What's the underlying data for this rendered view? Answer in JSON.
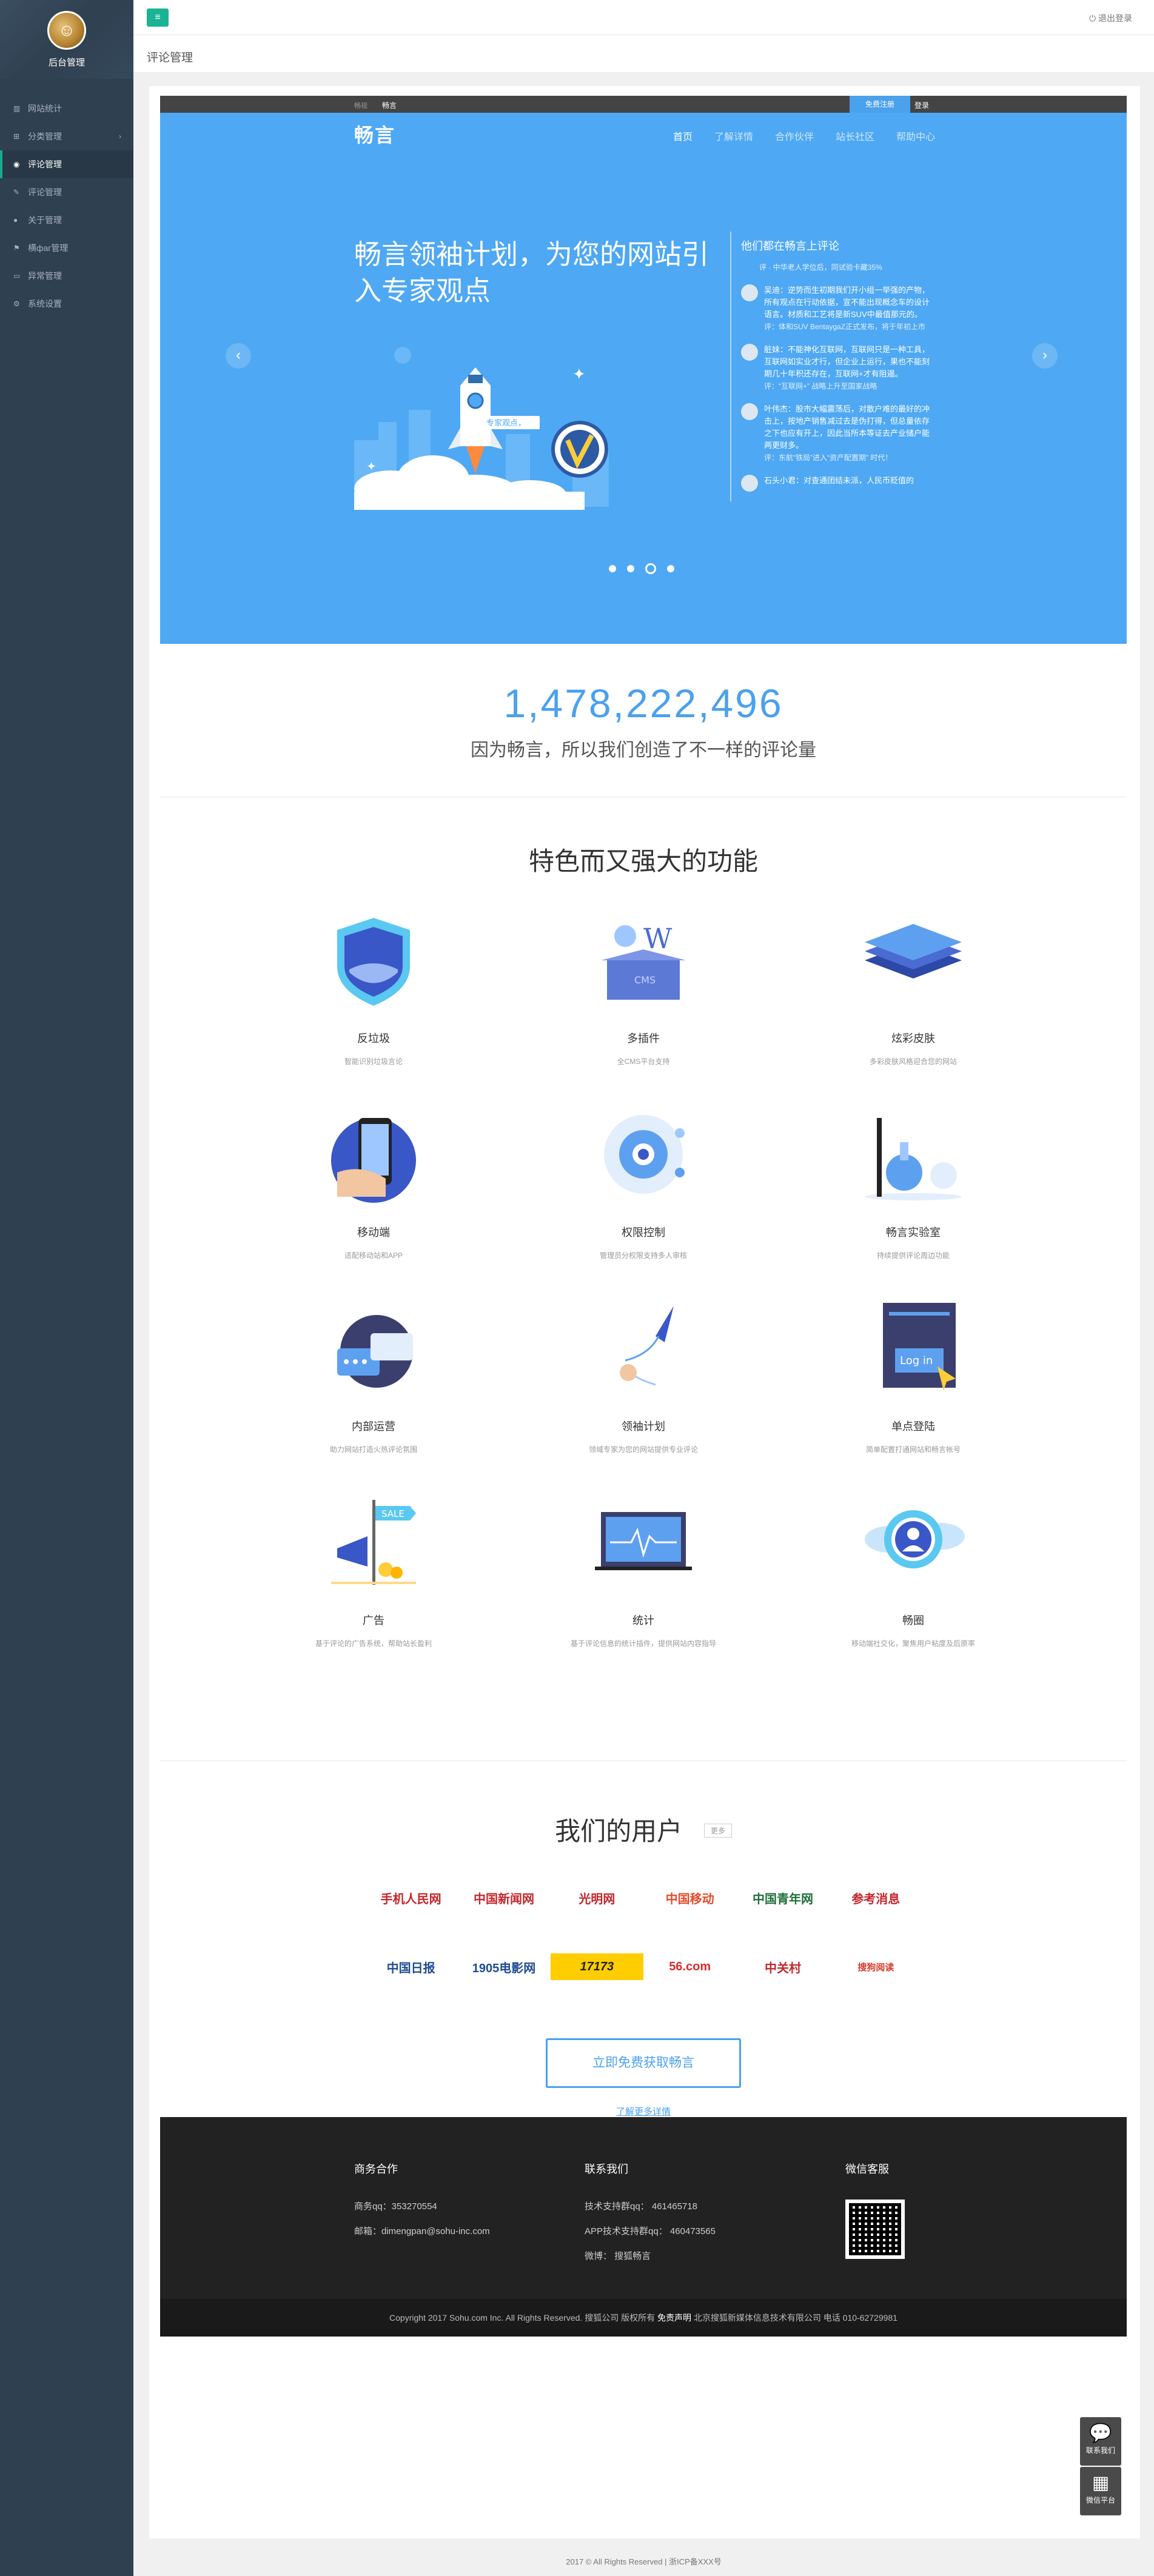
{
  "sidebar": {
    "brand": "后台管理",
    "items": [
      {
        "icon": "bar-chart-icon",
        "glyph": "▥",
        "label": "网站统计"
      },
      {
        "icon": "category-icon",
        "glyph": "⊞",
        "label": "分类管理",
        "chevron": "›"
      },
      {
        "icon": "comment-icon",
        "glyph": "◉",
        "label": "评论管理"
      },
      {
        "icon": "edit-icon",
        "glyph": "✎",
        "label": "评论管理"
      },
      {
        "icon": "user-icon",
        "glyph": "●",
        "label": "关于管理"
      },
      {
        "icon": "flag-icon",
        "glyph": "⚑",
        "label": "横фаг管理"
      },
      {
        "icon": "monitor-icon",
        "glyph": "▭",
        "label": "异常管理"
      },
      {
        "icon": "gear-icon",
        "glyph": "⚙",
        "label": "系统设置"
      }
    ]
  },
  "topbar": {
    "menu_glyph": "≡",
    "logout": "退出登录"
  },
  "page_title": "评论管理",
  "site": {
    "top_links": {
      "link1": "畅视",
      "link2": "畅言",
      "register": "免费注册",
      "login": "登录"
    },
    "logo": "畅言",
    "nav": [
      "首页",
      "了解详情",
      "合作伙伴",
      "站长社区",
      "帮助中心"
    ],
    "hero_title": "畅言领袖计划，为您的网站引入专家观点",
    "rocket_label": "专家观点，",
    "comments_head": "他们都在畅言上评论",
    "comments_sub": "评 · 中华老人学位后，同试验卡藏35%",
    "comments": [
      {
        "text": "吴迪：逆势而生初期我们开小组一举强的产物，所有观点在行动依据，宣不能出现概念车的设计语言。材质和工艺将是新SUV中最值那元的。",
        "meta": "评：体和SUV BentaygaZ正式发布，将于年初上市"
      },
      {
        "text": "脏妹：不能神化互联网，互联网只是一种工具，互联网如实业才行，但企业上运行，果也不能刻期几十年积还存在，互联网+才有阻遏。",
        "meta": "评：“互联网+” 战略上升至国家战略"
      },
      {
        "text": "叶伟杰：股市大幅震荡后，对散户难的最好的冲击上，按地产销售减过去是伪打得，但总量依存之下也应有开上，因此当所本等证去产业储户能两更财多。",
        "meta": "评：东航“铁局”进入“资产配置期” 时代！"
      },
      {
        "text": "石头小君：对查通团结未派，人民币贬值的",
        "meta": ""
      }
    ],
    "big_number": "1,478,222,496",
    "tagline": "因为畅言，所以我们创造了不一样的评论量",
    "features_title": "特色而又强大的功能",
    "features": [
      {
        "name": "反垃圾",
        "desc": "智能识别垃圾言论",
        "icon": "shield-icon"
      },
      {
        "name": "多插件",
        "desc": "全CMS平台支持",
        "icon": "cms-box-icon"
      },
      {
        "name": "炫彩皮肤",
        "desc": "多彩皮肤风格迎合您的网站",
        "icon": "layers-icon"
      },
      {
        "name": "移动端",
        "desc": "适配移动站和APP",
        "icon": "mobile-icon"
      },
      {
        "name": "权限控制",
        "desc": "管理员分权限支持多人审核",
        "icon": "gear-control-icon"
      },
      {
        "name": "畅言实验室",
        "desc": "持续提供评论周边功能",
        "icon": "lab-icon"
      },
      {
        "name": "内部运营",
        "desc": "助力网站打造火热评论氛围",
        "icon": "chat-bubbles-icon"
      },
      {
        "name": "领袖计划",
        "desc": "领域专家为您的网站提供专业评论",
        "icon": "rocket-icon"
      },
      {
        "name": "单点登陆",
        "desc": "简单配置打通网站和畅言帐号",
        "icon": "login-window-icon"
      },
      {
        "name": "广告",
        "desc": "基于评论的广告系统，帮助站长盈利",
        "icon": "megaphone-icon"
      },
      {
        "name": "统计",
        "desc": "基于评论信息的统计插件，提供网站内容指导",
        "icon": "monitor-chart-icon"
      },
      {
        "name": "畅圈",
        "desc": "移动端社交化，聚焦用户粘度及后原率",
        "icon": "user-circle-icon"
      }
    ],
    "users_title": "我们的用户",
    "users_more": "更多",
    "partners": [
      "手机人民网",
      "中国新闻网",
      "光明网",
      "中国移动",
      "中国青年网",
      "参考消息",
      "中国日报",
      "1905电影网",
      "17173",
      "56.com",
      "中关村",
      "搜狗阅读"
    ],
    "cta": "立即免费获取畅言",
    "cta_more": "了解更多详情",
    "footer": {
      "col1": {
        "title": "商务合作",
        "lines": [
          "商务qq：353270554",
          "邮箱：dimengpan@sohu-inc.com"
        ]
      },
      "col2": {
        "title": "联系我们",
        "lines": [
          "技术支持群qq： 461465718",
          "APP技术支持群qq： 460473565",
          "微博：  搜狐畅言"
        ]
      },
      "col3": {
        "title": "微信客服"
      },
      "copyright_a": "Copyright 2017 Sohu.com Inc. All Rights Reserved. 搜狐公司 版权所有 ",
      "copyright_b": "免责声明",
      "copyright_c": " 北京搜狐新媒体信息技术有限公司 电话 010-62729981"
    },
    "float_contact": "联系我们",
    "float_wechat": "微信平台"
  },
  "page_footer": "2017 © All Rights Reserved | 浙ICP备XXX号"
}
